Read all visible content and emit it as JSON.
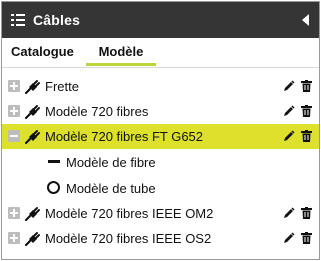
{
  "header": {
    "title": "Câbles"
  },
  "tabs": [
    {
      "label": "Catalogue"
    },
    {
      "label": "Modèle"
    }
  ],
  "active_tab": "Modèle",
  "tree": {
    "items": [
      {
        "label": "Frette",
        "expanded": false,
        "selected": false
      },
      {
        "label": "Modèle 720 fibres",
        "expanded": false,
        "selected": false
      },
      {
        "label": "Modèle 720 fibres FT G652",
        "expanded": true,
        "selected": true
      },
      {
        "label": "Modèle 720 fibres IEEE OM2",
        "expanded": false,
        "selected": false
      },
      {
        "label": "Modèle 720 fibres IEEE OS2",
        "expanded": false,
        "selected": false
      }
    ],
    "children": [
      {
        "label": "Modèle de fibre",
        "icon": "fiber-line-icon"
      },
      {
        "label": "Modèle de tube",
        "icon": "tube-circle-icon"
      }
    ]
  },
  "colors": {
    "header_bg": "#353535",
    "accent": "#bcd63a",
    "selected_row": "#dde12c",
    "toggle_bg": "#bdbdbd"
  }
}
